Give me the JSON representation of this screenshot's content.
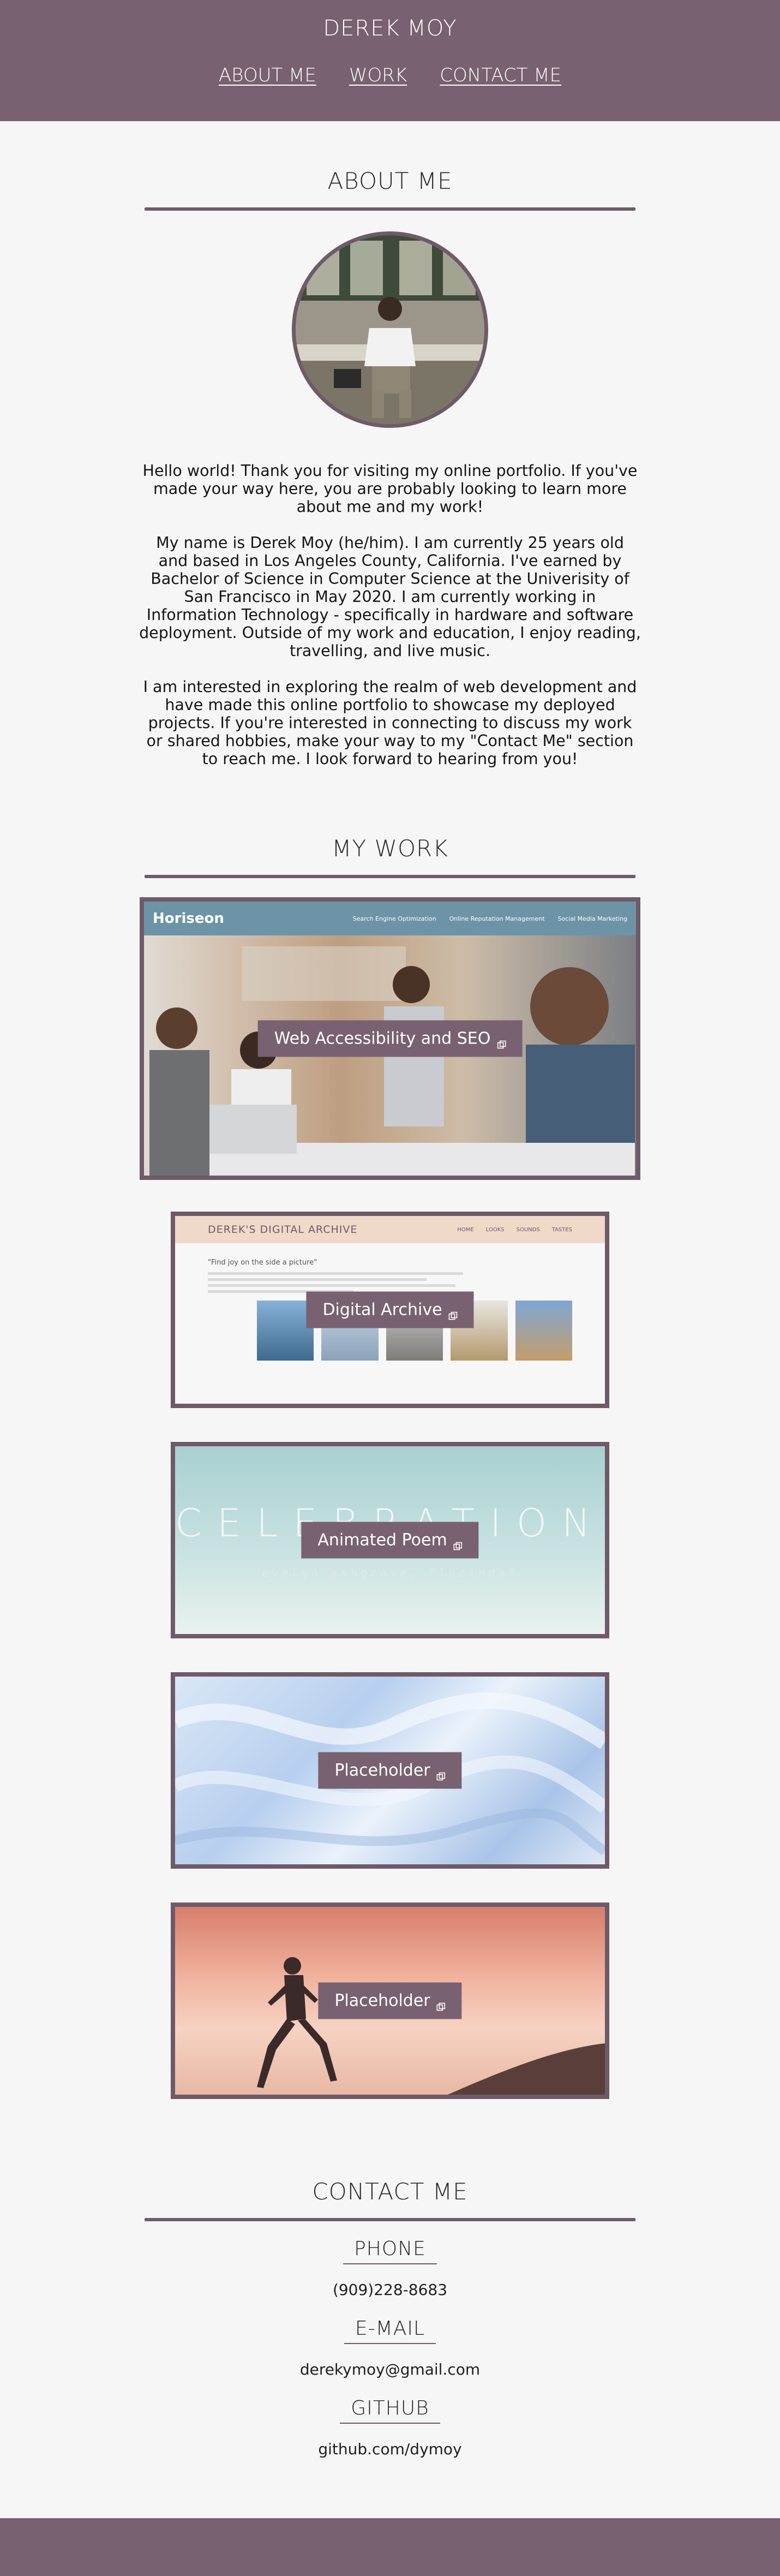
{
  "header": {
    "title": "DEREK MOY",
    "nav": [
      {
        "label": "ABOUT ME"
      },
      {
        "label": "WORK"
      },
      {
        "label": "CONTACT ME"
      }
    ]
  },
  "about": {
    "title": "ABOUT ME",
    "paragraphs": [
      "Hello world! Thank you for visiting my online portfolio. If you've made your way here, you are probably looking to learn more about me and my work!",
      "My name is Derek Moy (he/him). I am currently 25 years old and based in Los Angeles County, California. I've earned by Bachelor of Science in Computer Science at the Univerisity of San Francisco in May 2020. I am currently working in Information Technology - specifically in hardware and software deployment. Outside of my work and education, I enjoy reading, travelling, and live music.",
      "I am interested in exploring the realm of web development and have made this online portfolio to showcase my deployed projects. If you're interested in connecting to discuss my work or shared hobbies, make your way to my \"Contact Me\" section to reach me. I look forward to hearing from you!"
    ]
  },
  "work": {
    "title": "MY WORK",
    "projects": [
      {
        "label": "Web Accessibility and SEO",
        "preview": {
          "logo": "Horiseon",
          "links": [
            "Search Engine Optimization",
            "Online Reputation Management",
            "Social Media Marketing"
          ]
        }
      },
      {
        "label": "Digital Archive",
        "preview": {
          "title": "DEREK'S DIGITAL ARCHIVE",
          "links": [
            "HOME",
            "LOOKS",
            "SOUNDS",
            "TASTES"
          ],
          "quote": "\"Find joy on the side a picture\""
        }
      },
      {
        "label": "Animated Poem",
        "preview": {
          "title": "CELEBRATION",
          "subtitle": "evelyn ashgrove, \"lucinda\""
        }
      },
      {
        "label": "Placeholder"
      },
      {
        "label": "Placeholder"
      }
    ]
  },
  "contact": {
    "title": "CONTACT ME",
    "items": [
      {
        "heading": "PHONE",
        "value": "(909)228-8683"
      },
      {
        "heading": "E-MAIL",
        "value": "derekymoy@gmail.com"
      },
      {
        "heading": "GITHUB",
        "value": "github.com/dymoy"
      }
    ]
  },
  "icons": {
    "external": "external-link-icon"
  },
  "colors": {
    "accent": "#786170",
    "background": "#f6f6f6",
    "text": "#1f1f1f"
  }
}
